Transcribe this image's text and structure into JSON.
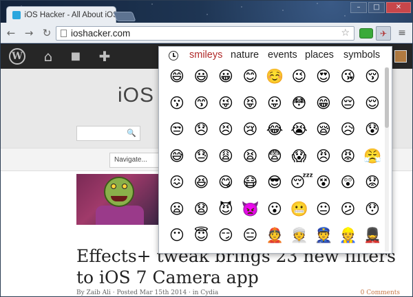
{
  "browser": {
    "tab_title": "iOS Hacker - All About iOS",
    "url": "ioshacker.com",
    "window_buttons": [
      "–",
      "□",
      "✕"
    ],
    "nav": {
      "back": "←",
      "forward": "→",
      "reload": "↻"
    },
    "star": "☆",
    "menu": "≡"
  },
  "wpbar": {
    "icons": [
      "wordpress-icon",
      "home-icon",
      "comment-icon",
      "plus-icon"
    ],
    "home": "⌂",
    "comment": "◼",
    "plus": "✚",
    "logo": "W"
  },
  "site": {
    "title": "iOS",
    "search_icon": "🔍",
    "nav_select": "Navigate...",
    "headline": "Effects+ tweak brings 23 new filters to iOS 7 Camera app",
    "byline": "By Zaib Ali · Posted Mar 15th 2014 · in Cydia",
    "comments": "0 Comments"
  },
  "popup": {
    "categories": [
      "smileys",
      "nature",
      "events",
      "places",
      "symbols"
    ],
    "active_category": "smileys",
    "emojis": [
      [
        "😄",
        "😃",
        "😀",
        "😊",
        "☺️",
        "😉",
        "😍",
        "😘",
        "😚"
      ],
      [
        "😗",
        "😙",
        "😜",
        "😝",
        "😛",
        "😳",
        "😁",
        "😔",
        "😌"
      ],
      [
        "😒",
        "😞",
        "😣",
        "😢",
        "😂",
        "😭",
        "😪",
        "😥",
        "😰"
      ],
      [
        "😅",
        "😓",
        "😩",
        "😫",
        "😨",
        "😱",
        "😠",
        "😡",
        "😤"
      ],
      [
        "😖",
        "😆",
        "😋",
        "😷",
        "😎",
        "😴",
        "😵",
        "😲",
        "😟"
      ],
      [
        "😦",
        "😧",
        "😈",
        "👿",
        "😮",
        "😬",
        "😐",
        "😕",
        "😯"
      ],
      [
        "😶",
        "😇",
        "😏",
        "😑",
        "👲",
        "👳",
        "👮",
        "👷",
        "💂"
      ]
    ]
  }
}
